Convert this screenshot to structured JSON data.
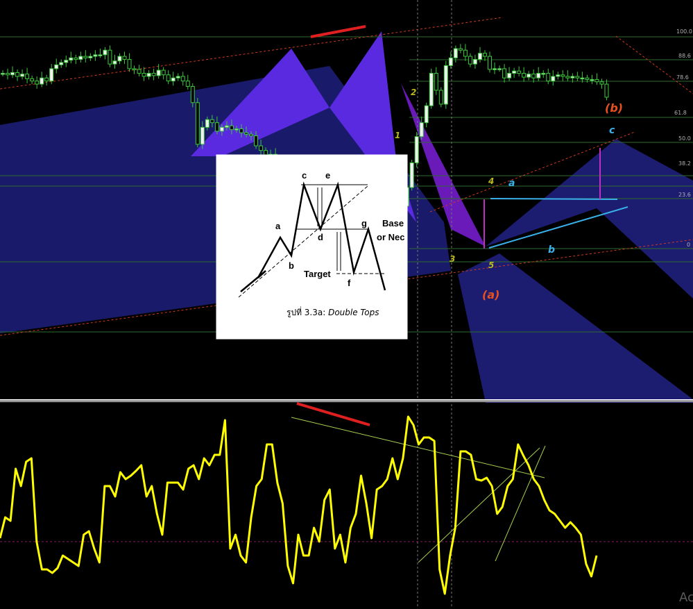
{
  "chart_data": [
    {
      "type": "candlestick",
      "panel": "price",
      "background": "#000000",
      "fib_levels": [
        "100.0",
        "88.6",
        "78.6",
        "61.8",
        "50.0",
        "38.2",
        "23.6",
        "0"
      ],
      "wave_labels": {
        "w1": "1",
        "w2": "2",
        "w3": "3",
        "w4": "4",
        "w5": "5",
        "a": "a",
        "b": "b",
        "c": "c",
        "big_a": "(a)",
        "big_b": "(b)"
      },
      "inset": {
        "labels": {
          "a": "a",
          "b": "b",
          "c": "c",
          "d": "d",
          "e": "e",
          "f": "f",
          "g": "g"
        },
        "base_text": "Base",
        "neck_text": "or Nec",
        "target_text": "Target",
        "caption_thai": "รูปที่ 3.3a: ",
        "caption_en": "Double Tops"
      },
      "candles_close": [
        300,
        298,
        301,
        296,
        299,
        293,
        290,
        286,
        294,
        290,
        306,
        311,
        314,
        317,
        320,
        318,
        322,
        320,
        322,
        324,
        324,
        330,
        312,
        316,
        322,
        318,
        306,
        305,
        300,
        296,
        300,
        297,
        304,
        298,
        290,
        294,
        296,
        290,
        283,
        262,
        208,
        230,
        240,
        236,
        225,
        230,
        232,
        227,
        228,
        223,
        221,
        219,
        206,
        200,
        188,
        195,
        186,
        178,
        183,
        178,
        165,
        158,
        150,
        155,
        172,
        160,
        112,
        88,
        96,
        108,
        110,
        136,
        128,
        150,
        128,
        85,
        112,
        102,
        80,
        76,
        128,
        140,
        128,
        152,
        184,
        218,
        236,
        258,
        300,
        278,
        260,
        310,
        320,
        332,
        330,
        322,
        312,
        318,
        326,
        322,
        305,
        306,
        306,
        294,
        300,
        303,
        300,
        295,
        299,
        294,
        300,
        300,
        290,
        296,
        298,
        296,
        294,
        296,
        294,
        294,
        292,
        292,
        289,
        286,
        269
      ]
    },
    {
      "type": "line",
      "panel": "oscillator",
      "color": "#ffff00",
      "values": [
        775,
        745,
        750,
        675,
        700,
        665,
        660,
        780,
        820,
        820,
        825,
        818,
        800,
        805,
        810,
        815,
        770,
        765,
        790,
        810,
        700,
        700,
        715,
        680,
        690,
        685,
        678,
        670,
        715,
        700,
        740,
        770,
        695,
        695,
        695,
        705,
        675,
        670,
        690,
        660,
        670,
        655,
        655,
        605,
        790,
        770,
        800,
        810,
        745,
        700,
        690,
        640,
        640,
        695,
        725,
        815,
        840,
        770,
        800,
        800,
        760,
        780,
        720,
        705,
        790,
        770,
        810,
        760,
        740,
        685,
        725,
        775,
        705,
        700,
        690,
        660,
        690,
        660,
        600,
        612,
        640,
        630,
        630,
        635,
        820,
        855,
        800,
        760,
        650,
        650,
        655,
        690,
        692,
        688,
        700,
        740,
        730,
        700,
        690,
        640,
        656,
        670,
        690,
        700,
        720,
        735,
        740,
        750,
        760,
        752,
        760,
        770,
        812,
        830,
        800
      ]
    }
  ]
}
